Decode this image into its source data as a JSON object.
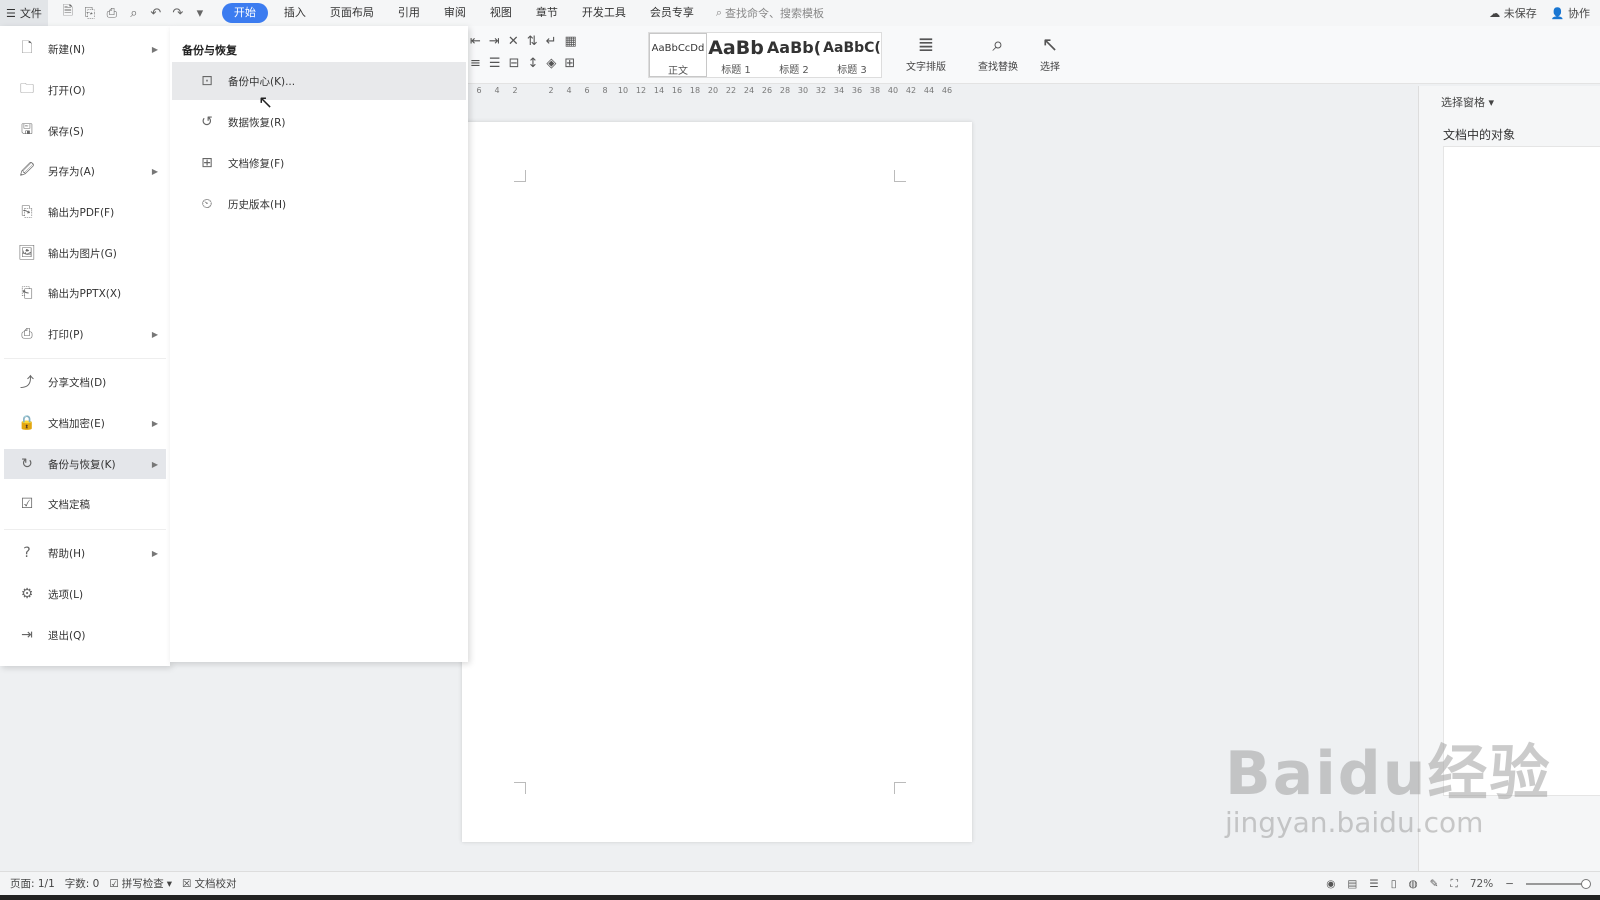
{
  "topbar": {
    "file_label": "文件",
    "tabs": [
      "开始",
      "插入",
      "页面布局",
      "引用",
      "审阅",
      "视图",
      "章节",
      "开发工具",
      "会员专享"
    ],
    "active_tab": "开始",
    "search_placeholder": "查找命令、搜索模板",
    "unsaved": "未保存",
    "collaborate": "协作"
  },
  "ribbon": {
    "styles": [
      {
        "preview": "AaBbCcDd",
        "label": "正文"
      },
      {
        "preview": "AaBb",
        "label": "标题 1"
      },
      {
        "preview": "AaBb(",
        "label": "标题 2"
      },
      {
        "preview": "AaBbC(",
        "label": "标题 3"
      }
    ],
    "text_layout": "文字排版",
    "find_replace": "查找替换",
    "select": "选择"
  },
  "ruler": [
    "6",
    "4",
    "2",
    "",
    "2",
    "4",
    "6",
    "8",
    "10",
    "12",
    "14",
    "16",
    "18",
    "20",
    "22",
    "24",
    "26",
    "28",
    "30",
    "32",
    "34",
    "36",
    "38",
    "40",
    "42",
    "44",
    "46"
  ],
  "file_menu": {
    "items": [
      {
        "label": "新建(N)",
        "icon": "new-doc-icon",
        "arrow": true
      },
      {
        "label": "打开(O)",
        "icon": "folder-icon",
        "arrow": false
      },
      {
        "label": "保存(S)",
        "icon": "save-icon",
        "arrow": false
      },
      {
        "label": "另存为(A)",
        "icon": "save-as-icon",
        "arrow": true
      },
      {
        "label": "输出为PDF(F)",
        "icon": "pdf-icon",
        "arrow": false
      },
      {
        "label": "输出为图片(G)",
        "icon": "image-icon",
        "arrow": false
      },
      {
        "label": "输出为PPTX(X)",
        "icon": "pptx-icon",
        "arrow": false
      },
      {
        "label": "打印(P)",
        "icon": "print-icon",
        "arrow": true
      },
      {
        "label": "分享文档(D)",
        "icon": "share-icon",
        "arrow": false
      },
      {
        "label": "文档加密(E)",
        "icon": "lock-doc-icon",
        "arrow": true
      },
      {
        "label": "备份与恢复(K)",
        "icon": "backup-icon",
        "arrow": true
      },
      {
        "label": "文档定稿",
        "icon": "check-doc-icon",
        "arrow": false
      },
      {
        "label": "帮助(H)",
        "icon": "help-icon",
        "arrow": true
      },
      {
        "label": "选项(L)",
        "icon": "gear-icon",
        "arrow": false
      },
      {
        "label": "退出(Q)",
        "icon": "exit-icon",
        "arrow": false
      }
    ]
  },
  "submenu": {
    "title": "备份与恢复",
    "items": [
      {
        "label": "备份中心(K)...",
        "icon": "backup-center-icon"
      },
      {
        "label": "数据恢复(R)",
        "icon": "restore-icon"
      },
      {
        "label": "文档修复(F)",
        "icon": "repair-icon"
      },
      {
        "label": "历史版本(H)",
        "icon": "history-icon"
      }
    ]
  },
  "right_pane": {
    "title": "选择窗格",
    "subtitle": "文档中的对象"
  },
  "statusbar": {
    "page": "页面: 1/1",
    "words": "字数: 0",
    "spell_check": "拼写检查",
    "proofread": "文档校对",
    "zoom": "72%"
  },
  "watermark": {
    "line1": "Baidu经验",
    "line2": "jingyan.baidu.com"
  }
}
